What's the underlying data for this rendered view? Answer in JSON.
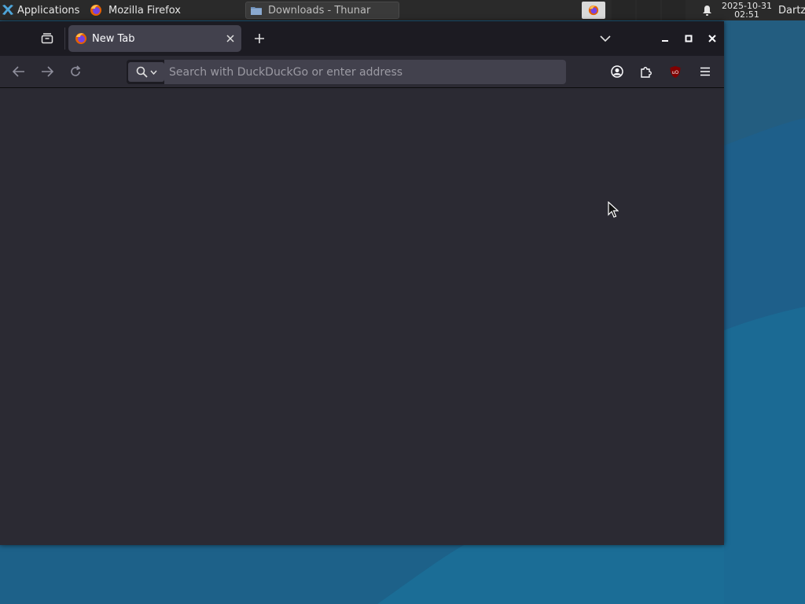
{
  "panel": {
    "applications_label": "Applications",
    "menu_separator": "☰",
    "tasks": [
      {
        "label": "Mozilla Firefox",
        "icon": "firefox-icon"
      },
      {
        "label": "Downloads - Thunar",
        "icon": "folder-icon"
      }
    ],
    "clock_date": "2025-10-31",
    "clock_time": "02:51",
    "user": "Dartz"
  },
  "browser": {
    "tab_title": "New Tab",
    "url_placeholder": "Search with DuckDuckGo or enter address",
    "ublock_badge": "uO"
  },
  "colors": {
    "window_bg": "#2b2a33",
    "tabbar_bg": "#1c1b22",
    "active_tab": "#42414d",
    "panel_bg": "#2a2a2a",
    "desktop": "#1f5f86"
  }
}
